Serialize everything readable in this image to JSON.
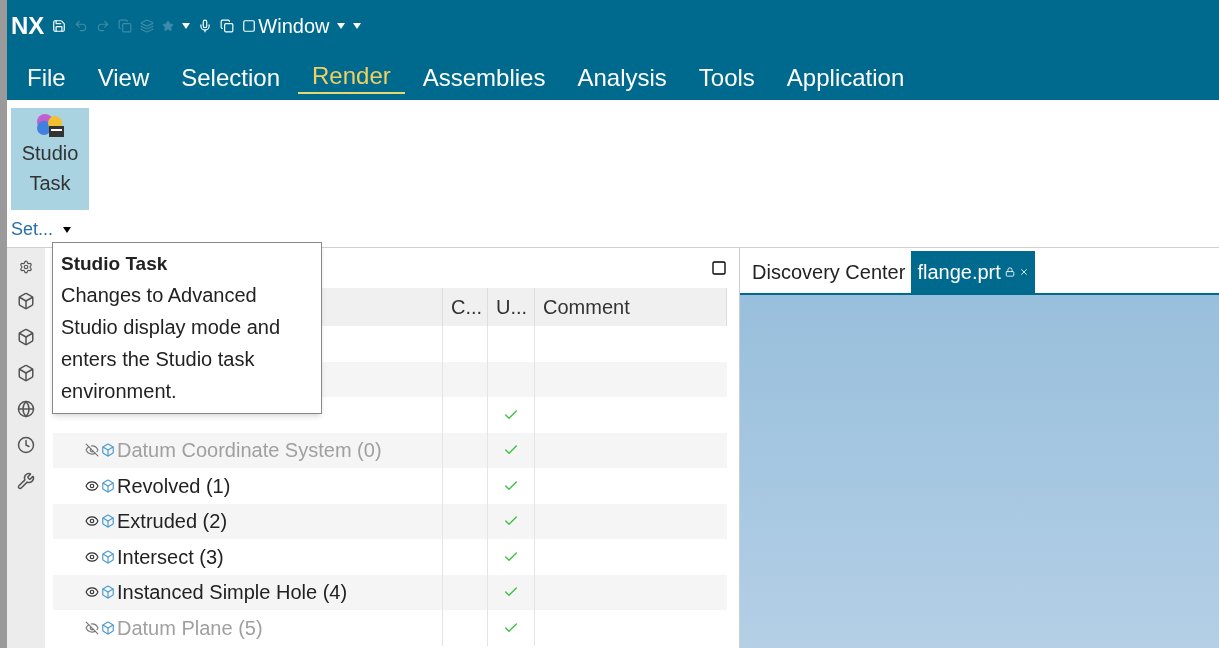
{
  "app": {
    "logo": "NX",
    "quick_access_label": "Window"
  },
  "menu": [
    {
      "label": "File",
      "selected": false
    },
    {
      "label": "View",
      "selected": false
    },
    {
      "label": "Selection",
      "selected": false
    },
    {
      "label": "Render",
      "selected": true
    },
    {
      "label": "Assemblies",
      "selected": false
    },
    {
      "label": "Analysis",
      "selected": false
    },
    {
      "label": "Tools",
      "selected": false
    },
    {
      "label": "Application",
      "selected": false
    }
  ],
  "ribbon": {
    "button": {
      "label": "Studio Task",
      "selected": true
    },
    "group_label": "Set..."
  },
  "tooltip": {
    "title": "Studio Task",
    "text": "Changes to Advanced Studio display mode and enters the Studio task environment."
  },
  "navigator": {
    "columns": [
      "C...",
      "U...",
      "Comment"
    ],
    "rows": [
      {
        "kind": "covered",
        "up_to_date": false
      },
      {
        "kind": "covered",
        "up_to_date": false
      },
      {
        "kind": "covered",
        "up_to_date": true
      },
      {
        "kind": "feature",
        "name": "Datum Coordinate System (0)",
        "visible": false,
        "up_to_date": true
      },
      {
        "kind": "feature",
        "name": "Revolved (1)",
        "visible": true,
        "up_to_date": true
      },
      {
        "kind": "feature",
        "name": "Extruded (2)",
        "visible": true,
        "up_to_date": true
      },
      {
        "kind": "feature",
        "name": "Intersect (3)",
        "visible": true,
        "up_to_date": true
      },
      {
        "kind": "feature",
        "name": "Instanced Simple Hole (4)",
        "visible": true,
        "up_to_date": true
      },
      {
        "kind": "feature",
        "name": "Datum Plane (5)",
        "visible": false,
        "up_to_date": true
      }
    ]
  },
  "graphics_tabs": [
    {
      "label": "Discovery Center",
      "selected": false
    },
    {
      "label": "flange.prt",
      "selected": true
    }
  ]
}
